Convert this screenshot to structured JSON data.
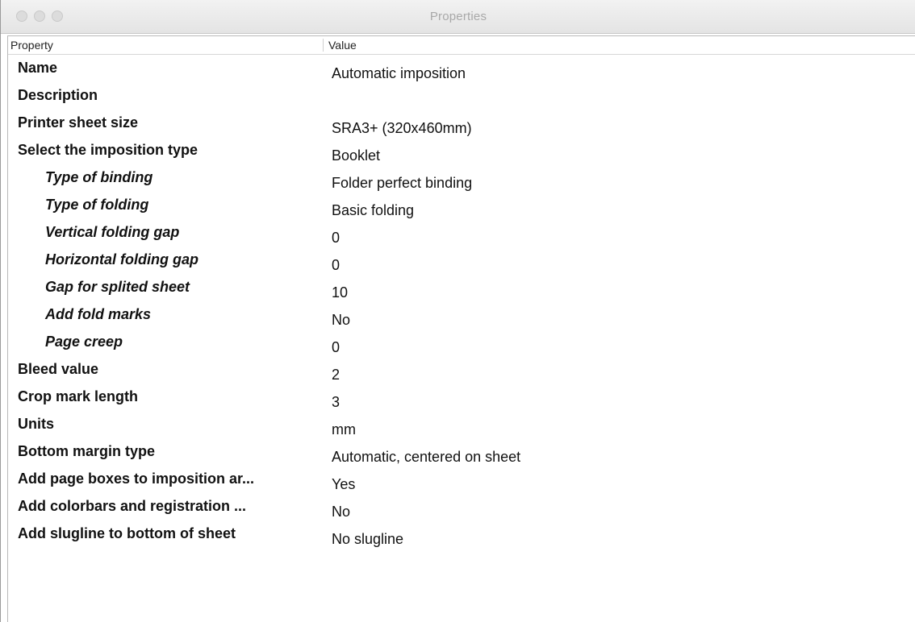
{
  "window": {
    "title": "Properties"
  },
  "table": {
    "columns": [
      "Property",
      "Value"
    ],
    "rows": [
      {
        "property": "Name",
        "value": "Automatic imposition",
        "indent": false
      },
      {
        "property": "Description",
        "value": "",
        "indent": false
      },
      {
        "property": "Printer sheet size",
        "value": "SRA3+ (320x460mm)",
        "indent": false
      },
      {
        "property": "Select the imposition type",
        "value": "Booklet",
        "indent": false
      },
      {
        "property": "Type of binding",
        "value": "Folder perfect binding",
        "indent": true
      },
      {
        "property": "Type of folding",
        "value": "Basic folding",
        "indent": true
      },
      {
        "property": "Vertical folding gap",
        "value": "0",
        "indent": true
      },
      {
        "property": "Horizontal folding gap",
        "value": "0",
        "indent": true
      },
      {
        "property": "Gap for splited sheet",
        "value": "10",
        "indent": true
      },
      {
        "property": "Add fold marks",
        "value": "No",
        "indent": true
      },
      {
        "property": "Page creep",
        "value": "0",
        "indent": true
      },
      {
        "property": "Bleed value",
        "value": "2",
        "indent": false
      },
      {
        "property": "Crop mark length",
        "value": "3",
        "indent": false
      },
      {
        "property": "Units",
        "value": "mm",
        "indent": false
      },
      {
        "property": "Bottom margin type",
        "value": "Automatic, centered on sheet",
        "indent": false
      },
      {
        "property": "Add page boxes to imposition ar...",
        "value": "Yes",
        "indent": false
      },
      {
        "property": "Add colorbars and registration ...",
        "value": "No",
        "indent": false
      },
      {
        "property": "Add slugline to bottom of sheet",
        "value": "No slugline",
        "indent": false
      }
    ]
  },
  "icons": {
    "close": "close-button-inactive",
    "minimize": "minimize-button-inactive",
    "zoom": "zoom-button-inactive"
  }
}
